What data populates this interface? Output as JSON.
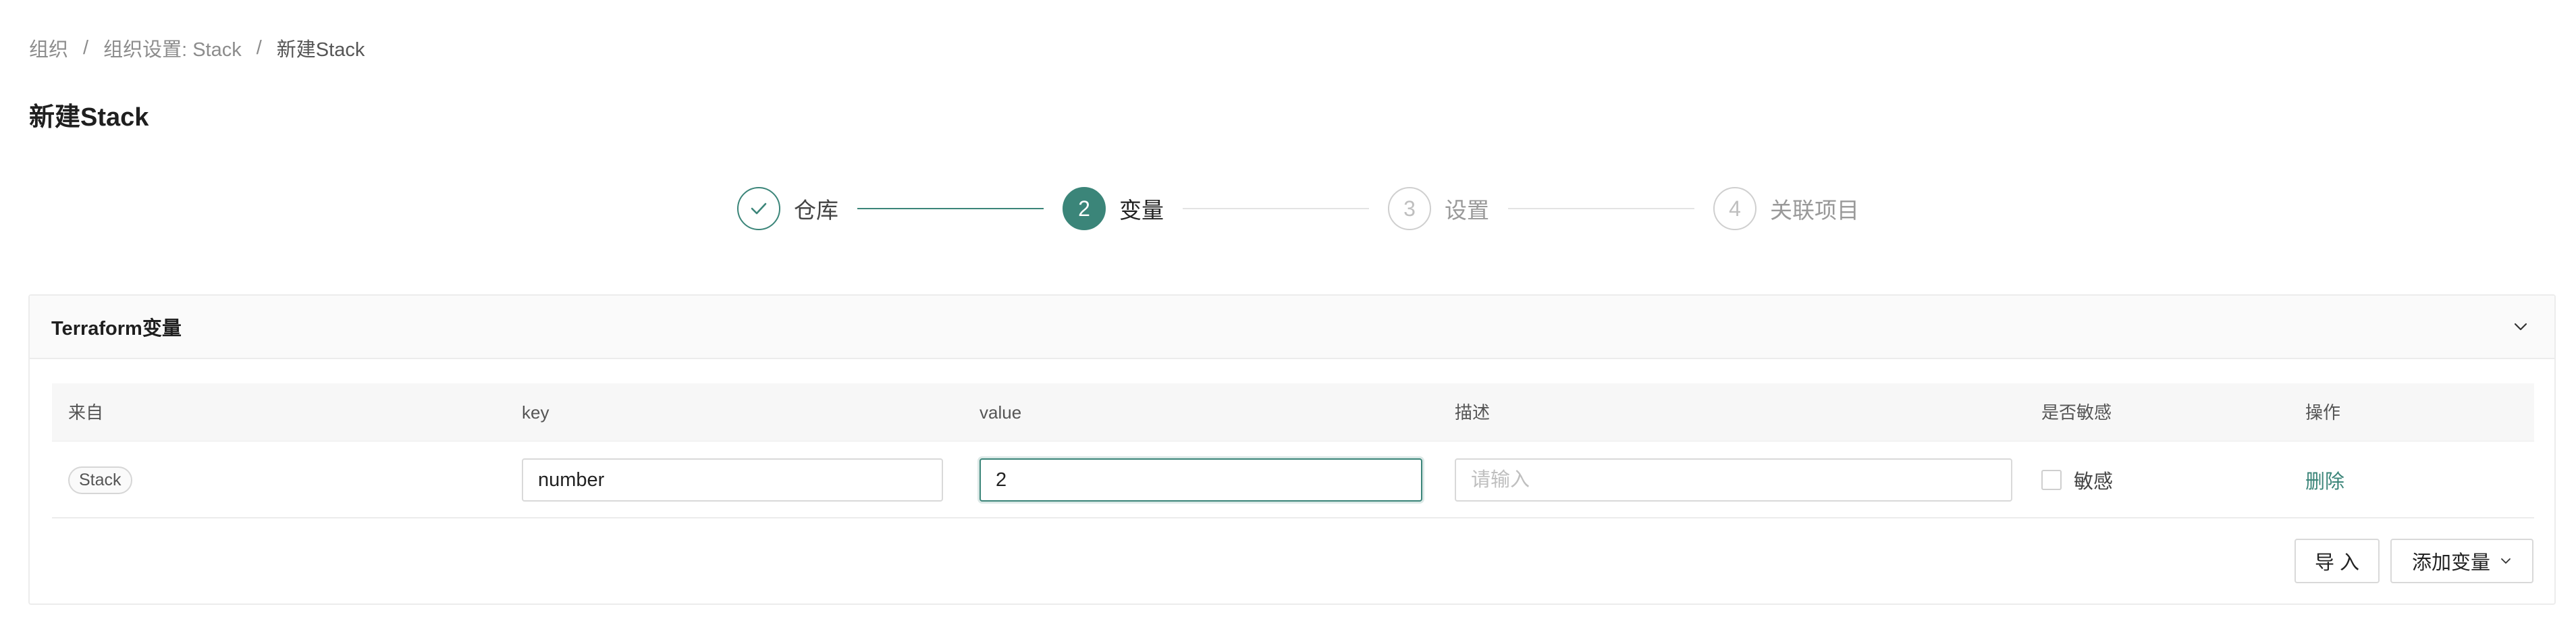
{
  "breadcrumb": {
    "items": [
      "组织",
      "组织设置: Stack",
      "新建Stack"
    ],
    "separator": "/"
  },
  "page_title": "新建Stack",
  "steps": [
    {
      "number": "1",
      "title": "仓库",
      "status": "done",
      "icon": "check-icon"
    },
    {
      "number": "2",
      "title": "变量",
      "status": "active"
    },
    {
      "number": "3",
      "title": "设置",
      "status": "wait"
    },
    {
      "number": "4",
      "title": "关联项目",
      "status": "wait"
    }
  ],
  "panel": {
    "title": "Terraform变量",
    "collapse_icon": "chevron-down-icon"
  },
  "table": {
    "columns": [
      "来自",
      "key",
      "value",
      "描述",
      "是否敏感",
      "操作"
    ],
    "rows": [
      {
        "source": "Stack",
        "key": "number",
        "value": "2",
        "description_placeholder": "请输入",
        "sensitive_label": "敏感",
        "sensitive": false,
        "action": "删除"
      }
    ]
  },
  "buttons": {
    "import": "导 入",
    "add_variable": "添加变量"
  },
  "colors": {
    "accent": "#3b8579",
    "border": "#d9d9d9",
    "header_bg": "#fafafa"
  }
}
